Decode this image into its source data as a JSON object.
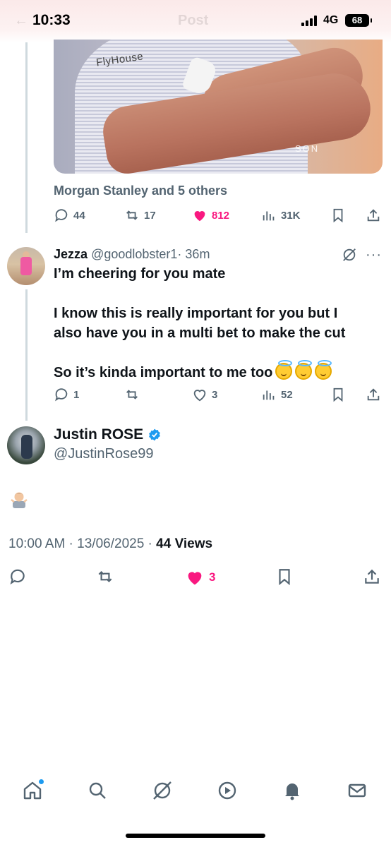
{
  "status_bar": {
    "time": "10:33",
    "network": "4G",
    "battery": "68",
    "header_title": "Post"
  },
  "previous_post": {
    "media_text": {
      "brand": "FlyHouse",
      "shirt_text": "SON"
    },
    "liked_by": "Morgan Stanley and 5 others",
    "actions": {
      "replies": "44",
      "reposts": "17",
      "likes": "812",
      "views": "31K",
      "liked": true
    }
  },
  "reply": {
    "name": "Jezza",
    "handle": "@goodlobster1",
    "time": "· 36m",
    "lines": [
      "I’m cheering for you mate",
      "I know this is really important for you but I",
      "also have you in a multi bet to make the cut",
      "So it’s kinda important to me too"
    ],
    "emojis": [
      "smiling-face-with-halo",
      "smiling-face-with-halo",
      "smiling-face-with-halo"
    ],
    "actions": {
      "replies": "1",
      "reposts": "",
      "likes": "3",
      "views": "52"
    }
  },
  "main_post": {
    "name": "Justin ROSE",
    "verified": true,
    "handle": "@JustinRose99",
    "body_emoji": "man-shrugging-emoji",
    "time": "10:00 AM",
    "date": "13/06/2025",
    "views_count": "44",
    "views_label": "Views",
    "actions": {
      "likes": "3",
      "liked": true
    }
  },
  "bottom_nav": [
    "home-icon",
    "search-icon",
    "grok-icon",
    "video-icon",
    "notifications-icon",
    "messages-icon"
  ],
  "colors": {
    "like": "#f91880",
    "secondary_text": "#536471",
    "accent": "#1d9bf0"
  }
}
